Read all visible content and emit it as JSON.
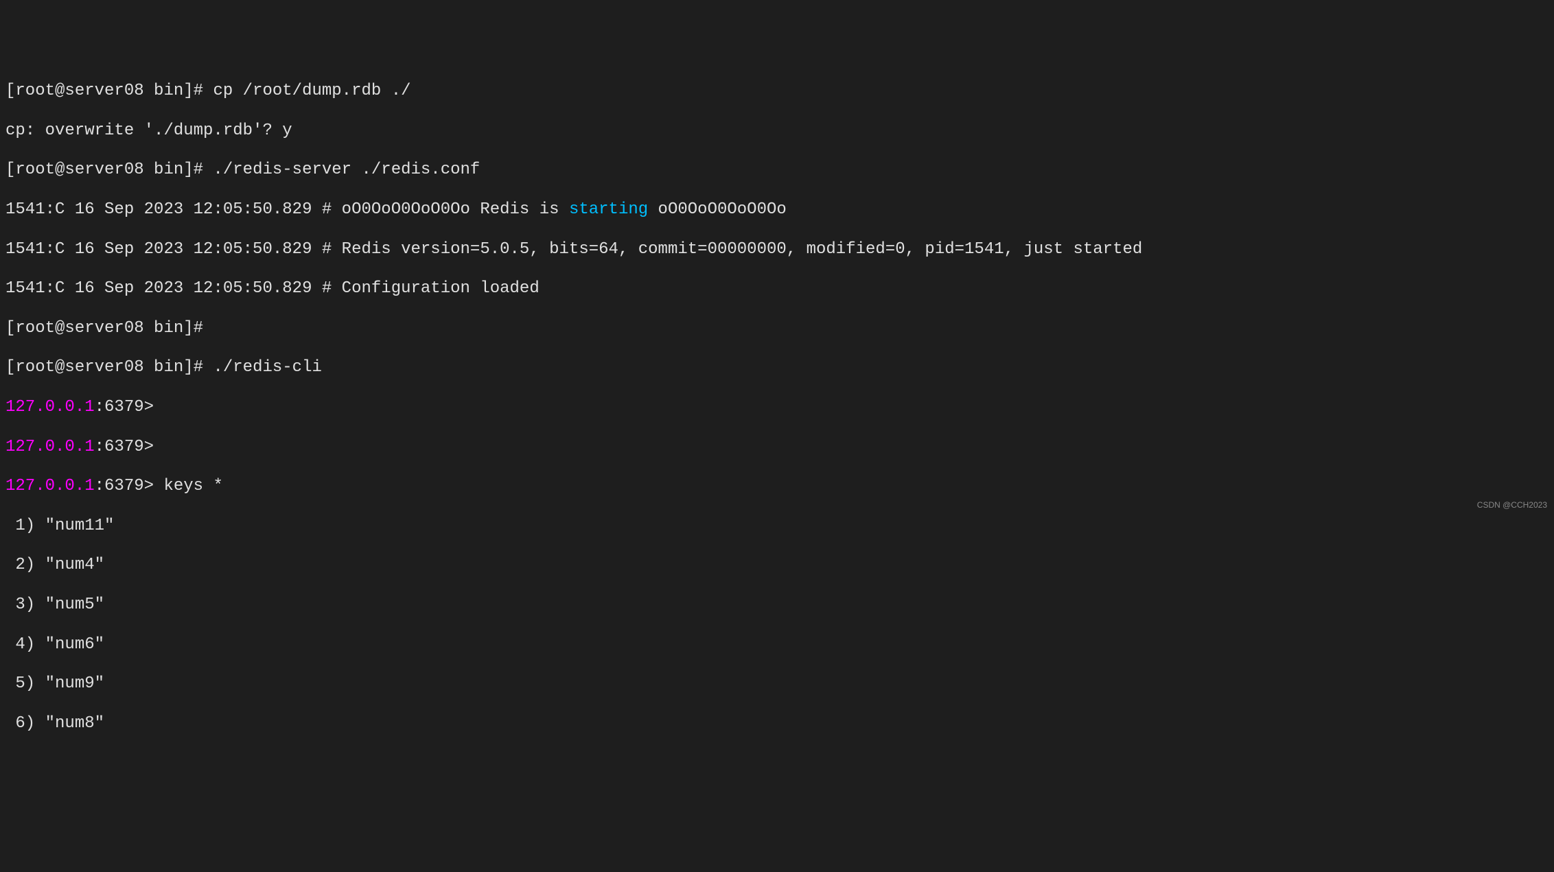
{
  "lines": {
    "prompt1": "[root@server08 bin]# ",
    "cmd1": "cp /root/dump.rdb ./",
    "overwrite": "cp: overwrite './dump.rdb'? y",
    "prompt2": "[root@server08 bin]# ",
    "cmd2": "./redis-server ./redis.conf",
    "log1_prefix": "1541:C 16 Sep 2023 12:05:50.829 # oO0OoO0OoO0Oo Redis is ",
    "log1_starting": "starting",
    "log1_suffix": " oO0OoO0OoO0Oo",
    "log2": "1541:C 16 Sep 2023 12:05:50.829 # Redis version=5.0.5, bits=64, commit=00000000, modified=0, pid=1541, just started",
    "log3": "1541:C 16 Sep 2023 12:05:50.829 # Configuration loaded",
    "prompt3": "[root@server08 bin]#",
    "prompt4": "[root@server08 bin]# ",
    "cmd4": "./redis-cli",
    "redis_ip": "127.0.0.1",
    "redis_port": ":6379>",
    "redis_empty": "",
    "redis_cmd": " keys *",
    "result1": " 1) \"num11\"",
    "result2": " 2) \"num4\"",
    "result3": " 3) \"num5\"",
    "result4": " 4) \"num6\"",
    "result5": " 5) \"num9\"",
    "result6": " 6) \"num8\""
  },
  "watermark": "CSDN @CCH2023"
}
